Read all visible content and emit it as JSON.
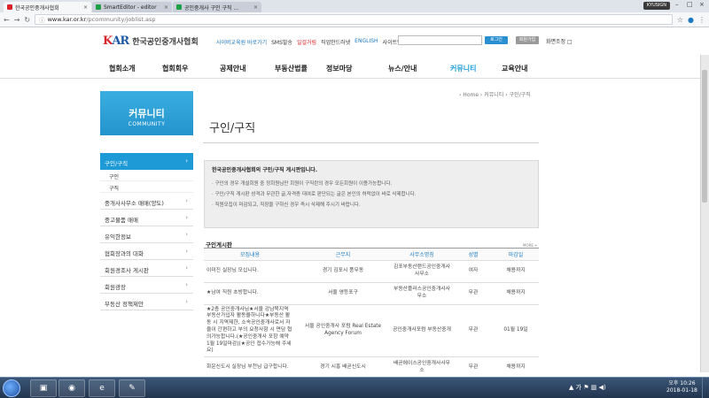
{
  "browser": {
    "tabs": [
      {
        "label": "한국공인중개사협회",
        "color": "#d8232a"
      },
      {
        "label": "SmartEditor - editor",
        "color": "#20a046"
      },
      {
        "label": "공인중개사 구인 구직 ...",
        "color": "#20a046"
      }
    ],
    "close_glyph": "×",
    "profile": "KYUSIGN",
    "url_host": "www.kar.or.kr",
    "url_path": "/pcommunity/joblist.asp"
  },
  "header": {
    "logo_mark_k": "K",
    "logo_mark_ar": "AR",
    "logo_name": "한국공인중개사협회",
    "util_links": [
      {
        "label": "사이버교육원 바로가기",
        "style": "hl1"
      },
      {
        "label": "SMS발송",
        "style": ""
      },
      {
        "label": "일걸거림",
        "style": "hl2"
      },
      {
        "label": "직업안드러넷",
        "style": ""
      },
      {
        "label": "ENGLISH",
        "style": "hl1"
      },
      {
        "label": "사이트맵",
        "style": ""
      }
    ],
    "login_label": "로그인",
    "join_label": "회원가입",
    "zoom_label": "화면조정 □"
  },
  "gnb": [
    {
      "label": "협회소개",
      "active": false
    },
    {
      "label": "협회회우",
      "active": false
    },
    {
      "label": "공제안내",
      "active": false
    },
    {
      "label": "부동산법률",
      "active": false
    },
    {
      "label": "정보마당",
      "active": false
    },
    {
      "label": "뉴스/안내",
      "active": false
    },
    {
      "label": "커뮤니티",
      "active": true
    },
    {
      "label": "교육안내",
      "active": false
    }
  ],
  "lnb": {
    "banner_title": "커뮤니티",
    "banner_subtitle": "COMMUNITY",
    "active_item": "구인/구직",
    "sub_items": [
      "구인",
      "구직"
    ],
    "items": [
      "중개사사무소 매매(양도)",
      "중고물품 매매",
      "유익한정보",
      "협회장과의 대화",
      "회원경조사 게시판",
      "회원광장",
      "부동산 정책제안"
    ],
    "arrow_glyph": "›"
  },
  "main": {
    "breadcrumb": "› Home › 커뮤니티 › 구인/구직",
    "page_title": "구인/구직",
    "notice_title": "한국공인중개사협회의 구인/구직 게시판입니다.",
    "notice_lines": [
      "· 구인의 경우 개설회원 중 정회원님만 회원이 구직란의 경우 모든회원이 이용가능합니다.",
      "· 구인/구직 게시판 성격과 무관한 글,자격증 대여로 판단되는 글은 본인의 허락없이 바로 삭제합니다.",
      "· 직원모집이 마감되고, 직장을 구하신 경우 즉시 삭제해 주시기 바랍니다."
    ],
    "board_title": "구인게시판",
    "board_more": "MORE +",
    "columns": [
      "모집내용",
      "근무지",
      "사무소명칭",
      "성별",
      "마감일"
    ],
    "rows": [
      {
        "content": "이미진 실장님 모십니다.",
        "location": "경기 김포시 풍무동",
        "office": "김포부동산랜드공인중개사사무소",
        "gender": "여자",
        "deadline": "채용까지"
      },
      {
        "content": "★남여 직원 초빙합니다.",
        "location": "서울 영등포구",
        "office": "부동산플러스공인중개사사무소",
        "gender": "무관",
        "deadline": "채용까지"
      },
      {
        "content": "★2층 공인중개사님★서울 강남북지역 부동산가입자 활동을하니다★부동산 활동 시 지역제한, 소속공인중개사로서 자율이 간편하고 부의 요청사항 시 면담 협의가능합니다.(★공인중개사 포함 예약 1월 19일마감)(★공인 접수가능해 주세요)",
        "location": "서울 공인중개사 포럼 Real Estate Agency Forum",
        "office": "공인중개사포럼 부동산중개",
        "gender": "무관",
        "deadline": "01월 19일"
      },
      {
        "content": "화운신도시 실장님 부천님 급구합니다.",
        "location": "경기 시흥 배곧신도시",
        "office": "배곧에이스공인중개사사무소",
        "gender": "무관",
        "deadline": "채용까지"
      },
      {
        "content": "▶김포한강신도시-소액펀입 실장님",
        "location": "경기 김포한강신도시",
        "office": "송파빌스타미트공인중개사사무소",
        "gender": "여자",
        "deadline": "채용까지"
      }
    ]
  },
  "taskbar": {
    "apps": [
      "▣",
      "◉",
      "e",
      "✎"
    ],
    "tray_text": "▲ 가 ⚑ ▥ ◀)",
    "clock_time": "오후 10:26",
    "clock_date": "2018-01-18"
  },
  "colors": {
    "accent": "#1e9ad6",
    "brand_blue": "#1d5aa8",
    "brand_red": "#d8232a"
  }
}
